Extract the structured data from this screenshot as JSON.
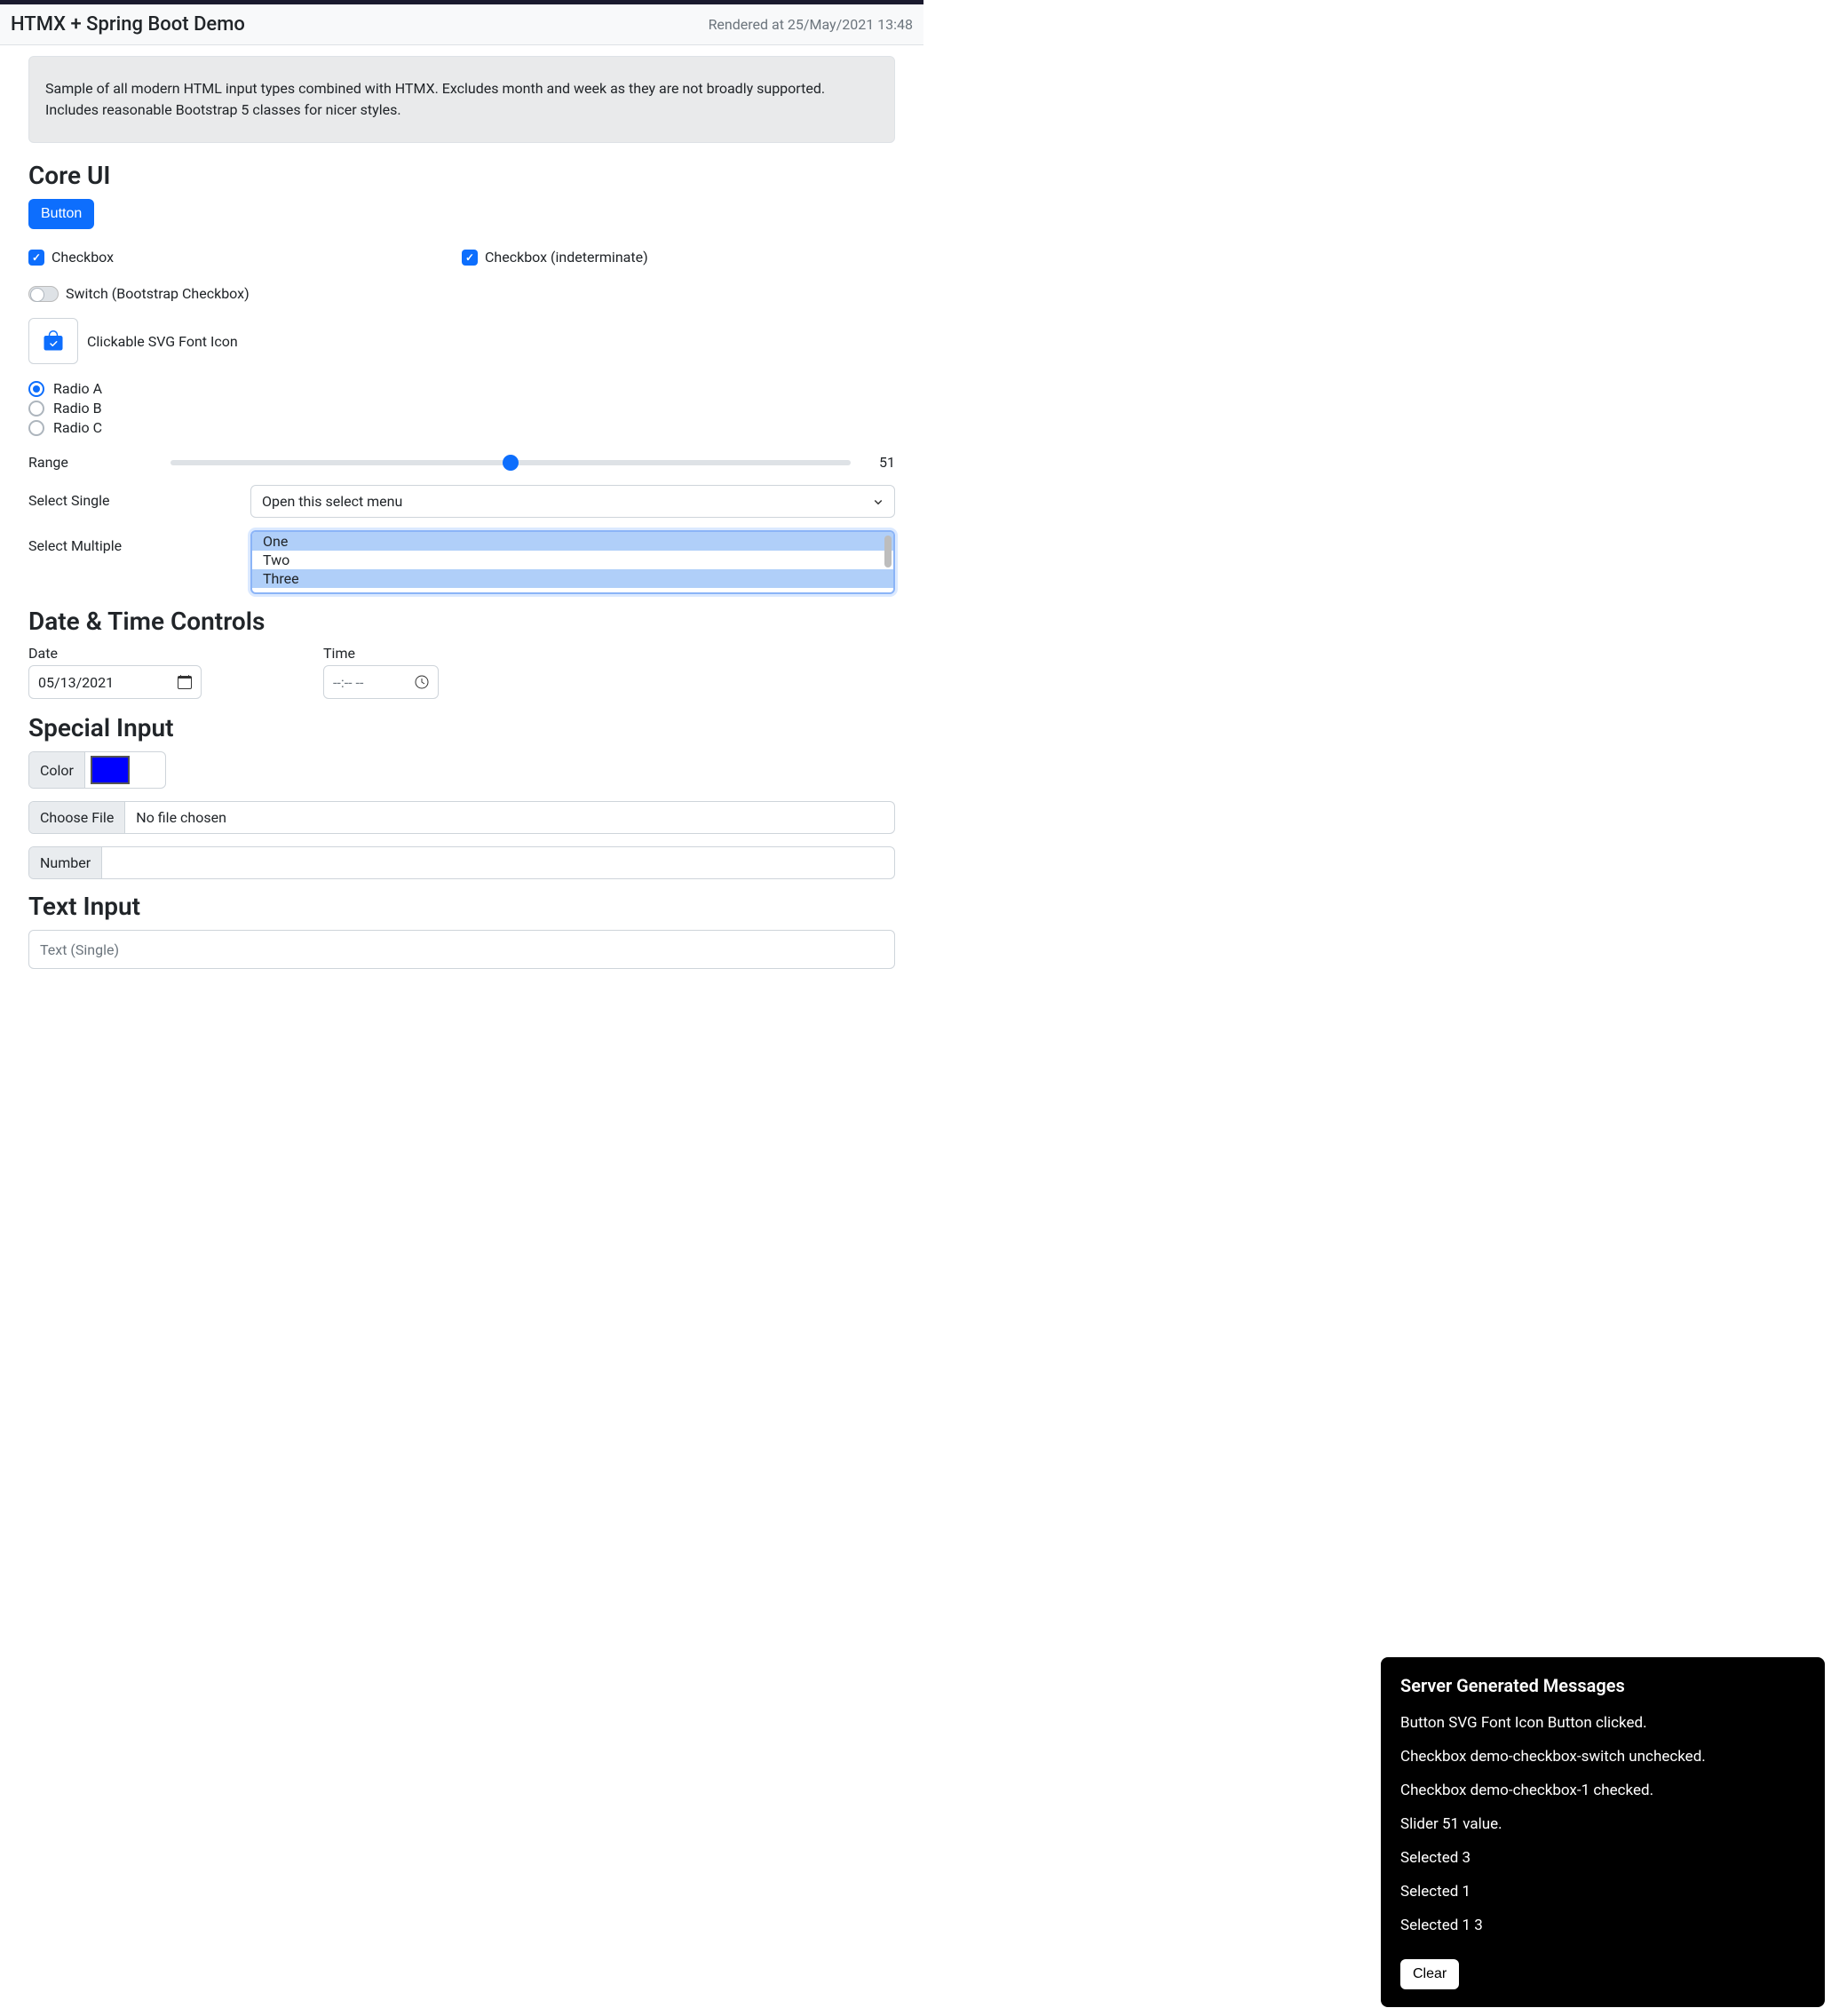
{
  "header": {
    "title": "HTMX + Spring Boot Demo",
    "timestamp": "Rendered at 25/May/2021 13:48"
  },
  "callout": "Sample of all modern HTML input types combined with HTMX. Excludes month and week as they are not broadly supported. Includes reasonable Bootstrap 5 classes for nicer styles.",
  "sections": {
    "core": "Core UI",
    "datetime": "Date & Time Controls",
    "special": "Special Input",
    "text": "Text Input"
  },
  "coreui": {
    "button_label": "Button",
    "checkbox1_label": "Checkbox",
    "checkbox2_label": "Checkbox (indeterminate)",
    "switch_label": "Switch (Bootstrap Checkbox)",
    "svg_label": "Clickable SVG Font Icon",
    "radio_a": "Radio A",
    "radio_b": "Radio B",
    "radio_c": "Radio C",
    "range_label": "Range",
    "range_value": "51",
    "select_single_label": "Select Single",
    "select_single_value": "Open this select menu",
    "select_multiple_label": "Select Multiple",
    "select_multiple_options": [
      "One",
      "Two",
      "Three"
    ]
  },
  "datetime": {
    "date_label": "Date",
    "date_value": "05/13/2021",
    "time_label": "Time",
    "time_value": "--:-- --"
  },
  "special": {
    "color_label": "Color",
    "color_value": "#0000ff",
    "file_button": "Choose File",
    "file_value": "No file chosen",
    "number_label": "Number"
  },
  "text": {
    "placeholder_single": "Text (Single)"
  },
  "toast": {
    "title": "Server Generated Messages",
    "messages": [
      "Button SVG Font Icon Button clicked.",
      "Checkbox demo-checkbox-switch unchecked.",
      "Checkbox demo-checkbox-1 checked.",
      "Slider 51 value.",
      "Selected 3",
      "Selected 1",
      "Selected 1 3"
    ],
    "clear_label": "Clear"
  }
}
